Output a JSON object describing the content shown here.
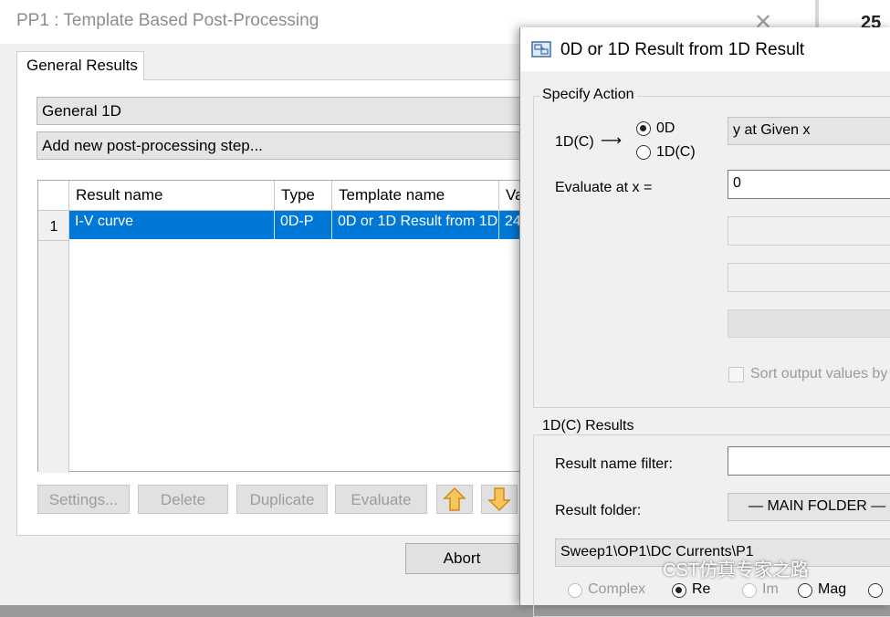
{
  "main_window": {
    "title": "PP1 : Template Based Post-Processing",
    "tab": "General Results",
    "combo_type": "General 1D",
    "combo_step": "Add new post-processing step...",
    "grid": {
      "columns": [
        "Result name",
        "Type",
        "Template name",
        "Va"
      ],
      "rows": [
        {
          "num": "1",
          "cells": [
            "I-V curve",
            "0D-P",
            "0D or 1D Result from 1D",
            "24"
          ]
        }
      ]
    },
    "buttons": {
      "settings": "Settings...",
      "delete": "Delete",
      "duplicate": "Duplicate",
      "evaluate": "Evaluate",
      "abort": "Abort"
    }
  },
  "background_number": "25",
  "dialog": {
    "title": "0D or 1D Result from 1D Result",
    "specify_action": {
      "label": "Specify Action",
      "input_label": "1D(C)",
      "arrow": "⟶",
      "radio_0d": "0D",
      "radio_1dc": "1D(C)",
      "action_combo": "y at Given x",
      "evaluate_label": "Evaluate at x =",
      "evaluate_value": "0",
      "sort_label": "Sort output values by"
    },
    "results": {
      "label": "1D(C) Results",
      "filter_label": "Result name filter:",
      "filter_value": "",
      "folder_label": "Result folder:",
      "folder_value": "— MAIN FOLDER —",
      "path_value": "Sweep1\\OP1\\DC Currents\\P1",
      "radio_complex": "Complex",
      "radio_re": "Re",
      "radio_im": "Im",
      "radio_mag": "Mag"
    }
  },
  "watermark": "CST仿真专家之路"
}
